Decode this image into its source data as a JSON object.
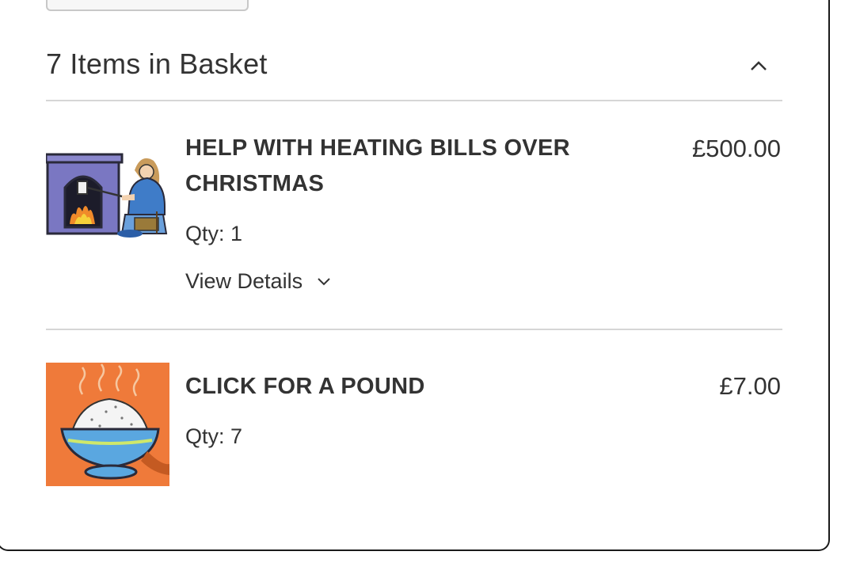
{
  "basket": {
    "summary_title": "7 Items in Basket",
    "items": [
      {
        "name": "HELP WITH HEATING BILLS OVER CHRISTMAS",
        "price": "£500.00",
        "qty": "Qty: 1",
        "view_details": "View Details",
        "image_icon": "fireplace-illustration"
      },
      {
        "name": "CLICK FOR A POUND",
        "price": "£7.00",
        "qty": "Qty: 7",
        "image_icon": "rice-bowl-illustration"
      }
    ]
  },
  "colors": {
    "border": "#1a1a1a",
    "divider": "#d6d6d6",
    "text": "#333333",
    "thumb_orange": "#ef7a3a"
  }
}
